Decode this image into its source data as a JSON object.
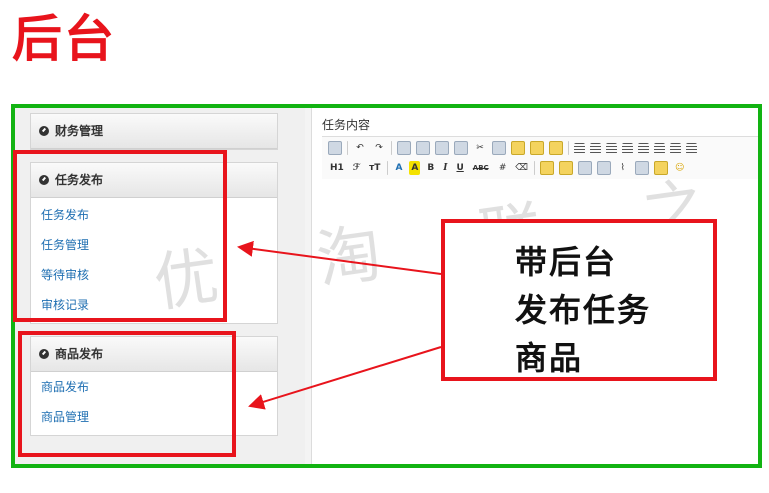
{
  "heading": "后台",
  "sidebar": {
    "panels": [
      {
        "title": "财务管理",
        "items": []
      },
      {
        "title": "任务发布",
        "items": [
          "任务发布",
          "任务管理",
          "等待审核",
          "审核记录"
        ]
      },
      {
        "title": "商品发布",
        "items": [
          "商品发布",
          "商品管理"
        ]
      }
    ]
  },
  "editor": {
    "label": "任务内容",
    "toolbar_text": {
      "heading": "H1",
      "font": "ℱ",
      "size": "тT",
      "font_color": "A",
      "bg_color": "A",
      "bold": "B",
      "italic": "I",
      "underline": "U",
      "strike": "ABC"
    }
  },
  "callout": {
    "lines": [
      "带后台",
      "发布任务",
      "商品"
    ]
  },
  "watermark": "优 淘 联 之 家",
  "colors": {
    "annotation_red": "#e8141c",
    "frame_green": "#12b312",
    "link_blue": "#1f6fb2"
  }
}
